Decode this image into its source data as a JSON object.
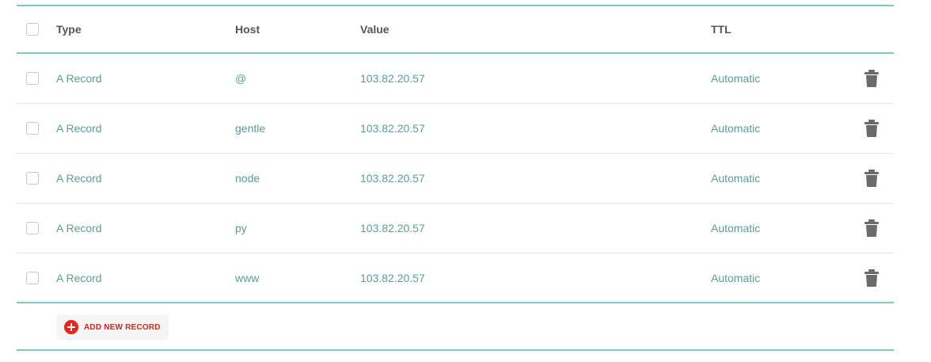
{
  "table": {
    "columns": {
      "type": "Type",
      "host": "Host",
      "value": "Value",
      "ttl": "TTL"
    },
    "rows": [
      {
        "type": "A Record",
        "host": "@",
        "value": "103.82.20.57",
        "ttl": "Automatic"
      },
      {
        "type": "A Record",
        "host": "gentle",
        "value": "103.82.20.57",
        "ttl": "Automatic"
      },
      {
        "type": "A Record",
        "host": "node",
        "value": "103.82.20.57",
        "ttl": "Automatic"
      },
      {
        "type": "A Record",
        "host": "py",
        "value": "103.82.20.57",
        "ttl": "Automatic"
      },
      {
        "type": "A Record",
        "host": "www",
        "value": "103.82.20.57",
        "ttl": "Automatic"
      }
    ],
    "row_action_icon": "trash-icon"
  },
  "footer": {
    "add_label": "ADD NEW RECORD",
    "add_icon": "plus-circle-icon"
  },
  "colors": {
    "accent_rule": "#7ec8c2",
    "row_text": "#5a9e98",
    "add_red": "#e8231b"
  }
}
